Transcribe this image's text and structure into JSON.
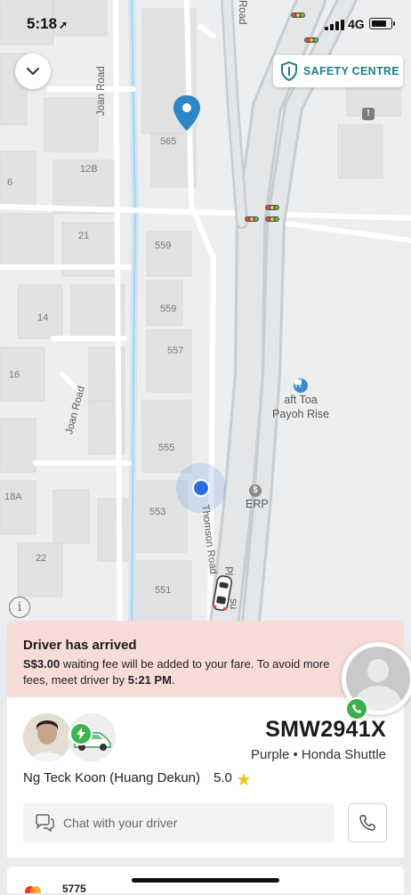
{
  "status_bar": {
    "time": "5:18",
    "network": "4G",
    "battery_level": 0.8
  },
  "map": {
    "safety_button_label": "SAFETY CENTRE",
    "road_labels": {
      "joan_road_top": "Joan Road",
      "joan_road_bottom": "Joan Road",
      "thomson_road": "Thomson Road",
      "road_top": "Road",
      "pi_label": "Pl",
      "su_label": "su"
    },
    "building_numbers": [
      "565",
      "12B",
      "6",
      "21",
      "559",
      "559",
      "14",
      "557",
      "16",
      "555",
      "553",
      "18A",
      "22",
      "551"
    ],
    "poi": {
      "bus_stop_line1": "aft Toa",
      "bus_stop_line2": "Payoh Rise",
      "erp_label": "ERP"
    },
    "icons": [
      "chevron-down-icon",
      "shield-icon",
      "info-icon",
      "location-pin-icon",
      "bus-stop-icon",
      "erp-icon",
      "car-icon",
      "user-location-icon"
    ]
  },
  "banner": {
    "title": "Driver has arrived",
    "fee": "S$3.00",
    "text_middle": " waiting fee will be added to your fare. To avoid more fees, meet driver by ",
    "deadline": "5:21 PM",
    "text_end": "."
  },
  "driver": {
    "name": "Ng Teck Koon (Huang Dekun)",
    "rating": "5.0",
    "plate": "SMW2941X",
    "car_model": "Purple • Honda Shuttle"
  },
  "actions": {
    "chat_label": "Chat with your driver"
  },
  "payment": {
    "text": "5775"
  },
  "colors": {
    "accent_teal": "#1e8080",
    "banner_bg": "#f8dcd8",
    "green": "#3cb14a",
    "pin_blue": "#2f86c7",
    "user_dot": "#2b6fe0"
  }
}
